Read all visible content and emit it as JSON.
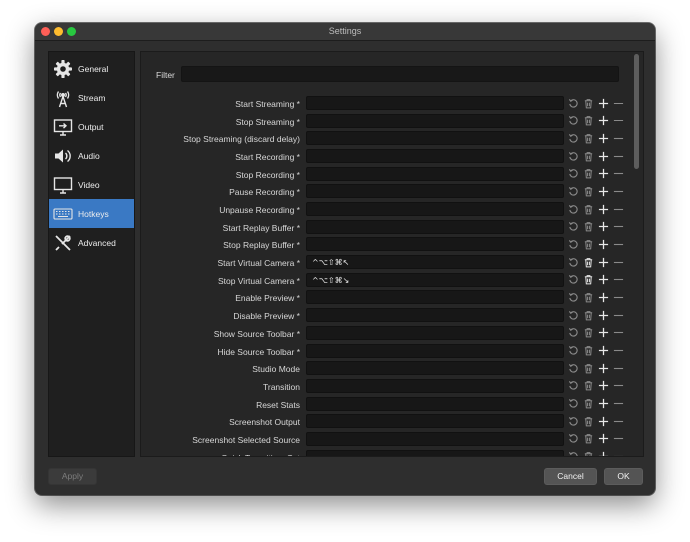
{
  "window": {
    "title": "Settings"
  },
  "sidebar": {
    "items": [
      {
        "label": "General",
        "icon": "gear-icon"
      },
      {
        "label": "Stream",
        "icon": "broadcast-tower-icon"
      },
      {
        "label": "Output",
        "icon": "output-monitor-icon"
      },
      {
        "label": "Audio",
        "icon": "speaker-icon"
      },
      {
        "label": "Video",
        "icon": "display-icon"
      },
      {
        "label": "Hotkeys",
        "icon": "keyboard-icon",
        "active": true
      },
      {
        "label": "Advanced",
        "icon": "tools-icon"
      }
    ]
  },
  "filter": {
    "label": "Filter",
    "value": ""
  },
  "hotkeys": [
    {
      "label": "Start Streaming *",
      "value": ""
    },
    {
      "label": "Stop Streaming *",
      "value": ""
    },
    {
      "label": "Stop Streaming (discard delay)",
      "value": ""
    },
    {
      "label": "Start Recording *",
      "value": ""
    },
    {
      "label": "Stop Recording *",
      "value": ""
    },
    {
      "label": "Pause Recording *",
      "value": ""
    },
    {
      "label": "Unpause Recording *",
      "value": ""
    },
    {
      "label": "Start Replay Buffer *",
      "value": ""
    },
    {
      "label": "Stop Replay Buffer *",
      "value": ""
    },
    {
      "label": "Start Virtual Camera *",
      "value": "^⌥⇧⌘↖"
    },
    {
      "label": "Stop Virtual Camera *",
      "value": "^⌥⇧⌘↘"
    },
    {
      "label": "Enable Preview *",
      "value": ""
    },
    {
      "label": "Disable Preview *",
      "value": ""
    },
    {
      "label": "Show Source Toolbar *",
      "value": ""
    },
    {
      "label": "Hide Source Toolbar *",
      "value": ""
    },
    {
      "label": "Studio Mode",
      "value": ""
    },
    {
      "label": "Transition",
      "value": ""
    },
    {
      "label": "Reset Stats",
      "value": ""
    },
    {
      "label": "Screenshot Output",
      "value": ""
    },
    {
      "label": "Screenshot Selected Source",
      "value": ""
    },
    {
      "label": "Quick Transition: Cut",
      "value": ""
    }
  ],
  "buttons": {
    "apply": "Apply",
    "cancel": "Cancel",
    "ok": "OK"
  },
  "colors": {
    "accent": "#3a79c4",
    "window_bg": "#2e2e2e",
    "panel_bg": "#262626"
  }
}
